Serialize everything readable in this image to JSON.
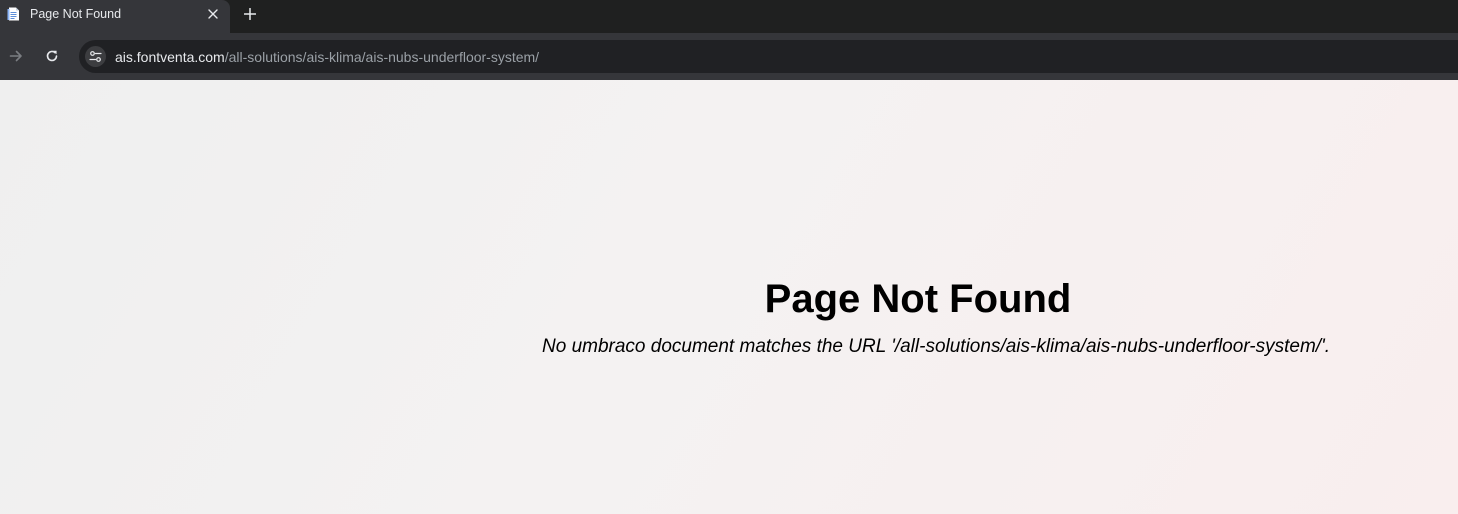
{
  "browser": {
    "tab": {
      "title": "Page Not Found",
      "favicon": "document-icon",
      "close_icon": "close-icon"
    },
    "new_tab_icon": "plus-icon",
    "toolbar": {
      "forward_icon": "arrow-right-icon",
      "reload_icon": "reload-icon",
      "site_info_icon": "tune-icon",
      "url_host": "ais.fontventa.com",
      "url_path": "/all-solutions/ais-klima/ais-nubs-underfloor-system/"
    },
    "colors": {
      "tabstrip": "#1f2020",
      "active_tab": "#35363a",
      "omnibox": "#202124",
      "page_background": "#f4f2f2"
    }
  },
  "page": {
    "heading": "Page Not Found",
    "message": "No umbraco document matches the URL '/all-solutions/ais-klima/ais-nubs-underfloor-system/'."
  }
}
